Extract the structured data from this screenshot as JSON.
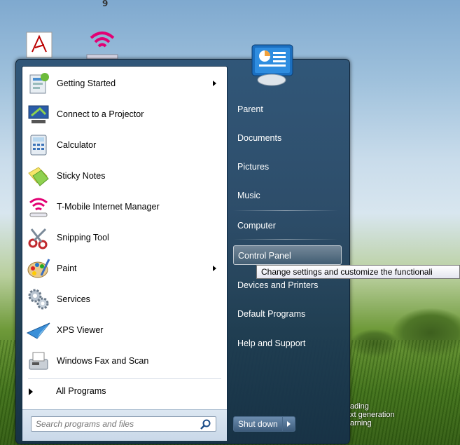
{
  "desktop": {
    "top_digit": "9"
  },
  "start_menu": {
    "programs": [
      {
        "label": "Getting Started",
        "icon": "getting-started-icon",
        "has_submenu": true
      },
      {
        "label": "Connect to a Projector",
        "icon": "projector-icon",
        "has_submenu": false
      },
      {
        "label": "Calculator",
        "icon": "calculator-icon",
        "has_submenu": false
      },
      {
        "label": "Sticky Notes",
        "icon": "sticky-notes-icon",
        "has_submenu": false
      },
      {
        "label": "T-Mobile Internet Manager",
        "icon": "wifi-icon",
        "has_submenu": false
      },
      {
        "label": "Snipping Tool",
        "icon": "scissors-icon",
        "has_submenu": false
      },
      {
        "label": "Paint",
        "icon": "paint-palette-icon",
        "has_submenu": true
      },
      {
        "label": "Services",
        "icon": "gears-icon",
        "has_submenu": false
      },
      {
        "label": "XPS Viewer",
        "icon": "paper-plane-icon",
        "has_submenu": false
      },
      {
        "label": "Windows Fax and Scan",
        "icon": "fax-icon",
        "has_submenu": false
      }
    ],
    "all_programs_label": "All Programs",
    "search": {
      "placeholder": "Search programs and files"
    },
    "right_pane": [
      {
        "label": "Parent"
      },
      {
        "label": "Documents"
      },
      {
        "label": "Pictures"
      },
      {
        "label": "Music"
      },
      {
        "label": "Computer"
      },
      {
        "label": "Control Panel"
      },
      {
        "label": "Devices and Printers"
      },
      {
        "label": "Default Programs"
      },
      {
        "label": "Help and Support"
      }
    ],
    "tooltip": "Change settings and customize the functionali",
    "shutdown_label": "Shut down"
  },
  "watermark": {
    "line1": "ading",
    "line2": "xt generation",
    "line3": "arning"
  }
}
